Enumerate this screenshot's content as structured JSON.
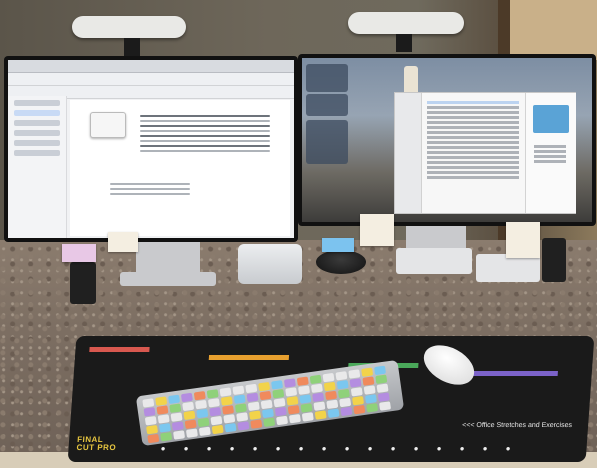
{
  "mat": {
    "title_line1": "FINAL",
    "title_line2": "CUT PRO",
    "banner": "<<< Office Stretches and Exercises"
  },
  "icons": {
    "lamp": "light-bar-icon",
    "stretch_figures": "stretch-figure-icon"
  },
  "colors": {
    "mat_title": "#e7c640",
    "keyboard_accent": "#5aa3d6",
    "finder_highlight": "#bcd3f0"
  }
}
